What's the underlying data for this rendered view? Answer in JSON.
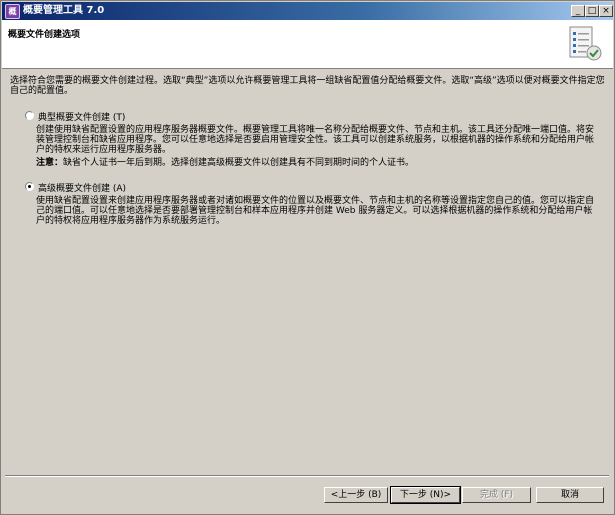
{
  "window": {
    "title": "概要管理工具 7.0",
    "controls": {
      "minimize": "_",
      "maximize": "□",
      "close": "×"
    }
  },
  "header": {
    "title": "概要文件创建选项"
  },
  "intro": "选择符合您需要的概要文件创建过程。选取“典型”选项以允许概要管理工具将一组缺省配置值分配给概要文件。选取“高级”选项以便对概要文件指定您自己的配置值。",
  "options": {
    "typical": {
      "label": "典型概要文件创建 (T)",
      "selected": false,
      "description": "创建使用缺省配置设置的应用程序服务器概要文件。概要管理工具将唯一名称分配给概要文件、节点和主机。该工具还分配唯一端口值。将安装管理控制台和缺省应用程序。您可以任意地选择是否要启用管理安全性。该工具可以创建系统服务，以根据机器的操作系统和分配给用户帐户的特权来运行应用程序服务器。",
      "note_label": "注意：",
      "note_text": "缺省个人证书一年后到期。选择创建高级概要文件以创建具有不同到期时间的个人证书。"
    },
    "advanced": {
      "label": "高级概要文件创建 (A)",
      "selected": true,
      "description": "使用缺省配置设置来创建应用程序服务器或者对诸如概要文件的位置以及概要文件、节点和主机的名称等设置指定您自己的值。您可以指定自己的端口值。可以任意地选择是否要部署管理控制台和样本应用程序并创建 Web 服务器定义。可以选择根据机器的操作系统和分配给用户帐户的特权将应用程序服务器作为系统服务运行。"
    }
  },
  "buttons": {
    "back": "<上一步 (B)",
    "next": "下一步 (N)>",
    "finish": "完成 (F)",
    "cancel": "取消"
  },
  "icons": {
    "app": "profile-tool-icon",
    "header": "document-checklist-icon"
  }
}
